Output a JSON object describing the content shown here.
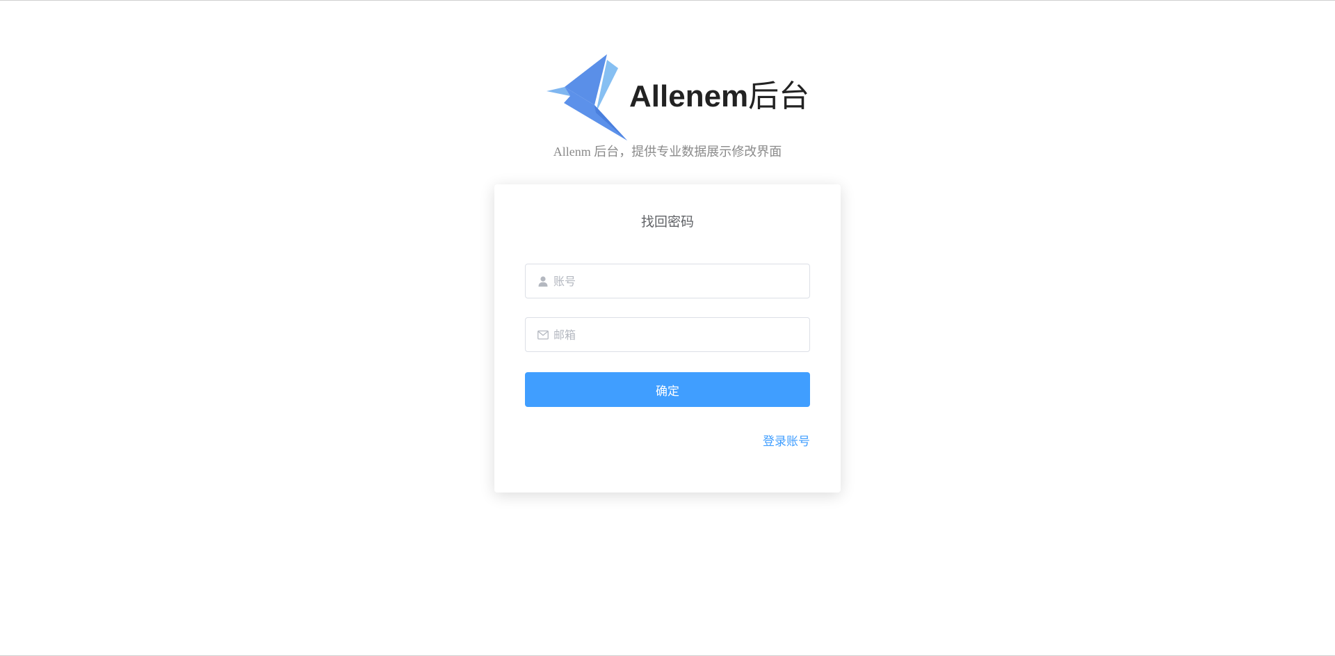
{
  "header": {
    "title_latin": "Allenem",
    "title_cjk": "后台",
    "subtitle": "Allenm 后台，提供专业数据展示修改界面",
    "logo_icon": "origami-bird-logo"
  },
  "form": {
    "title": "找回密码",
    "account": {
      "icon": "user-icon",
      "placeholder": "账号",
      "value": ""
    },
    "email": {
      "icon": "mail-icon",
      "placeholder": "邮箱",
      "value": ""
    },
    "submit_label": "确定",
    "login_link_label": "登录账号"
  },
  "colors": {
    "primary": "#409eff",
    "logo_dark": "#5a8fe8",
    "logo_light": "#7fb6f0",
    "placeholder": "#b4b8c0",
    "border": "#dcdfe6"
  }
}
